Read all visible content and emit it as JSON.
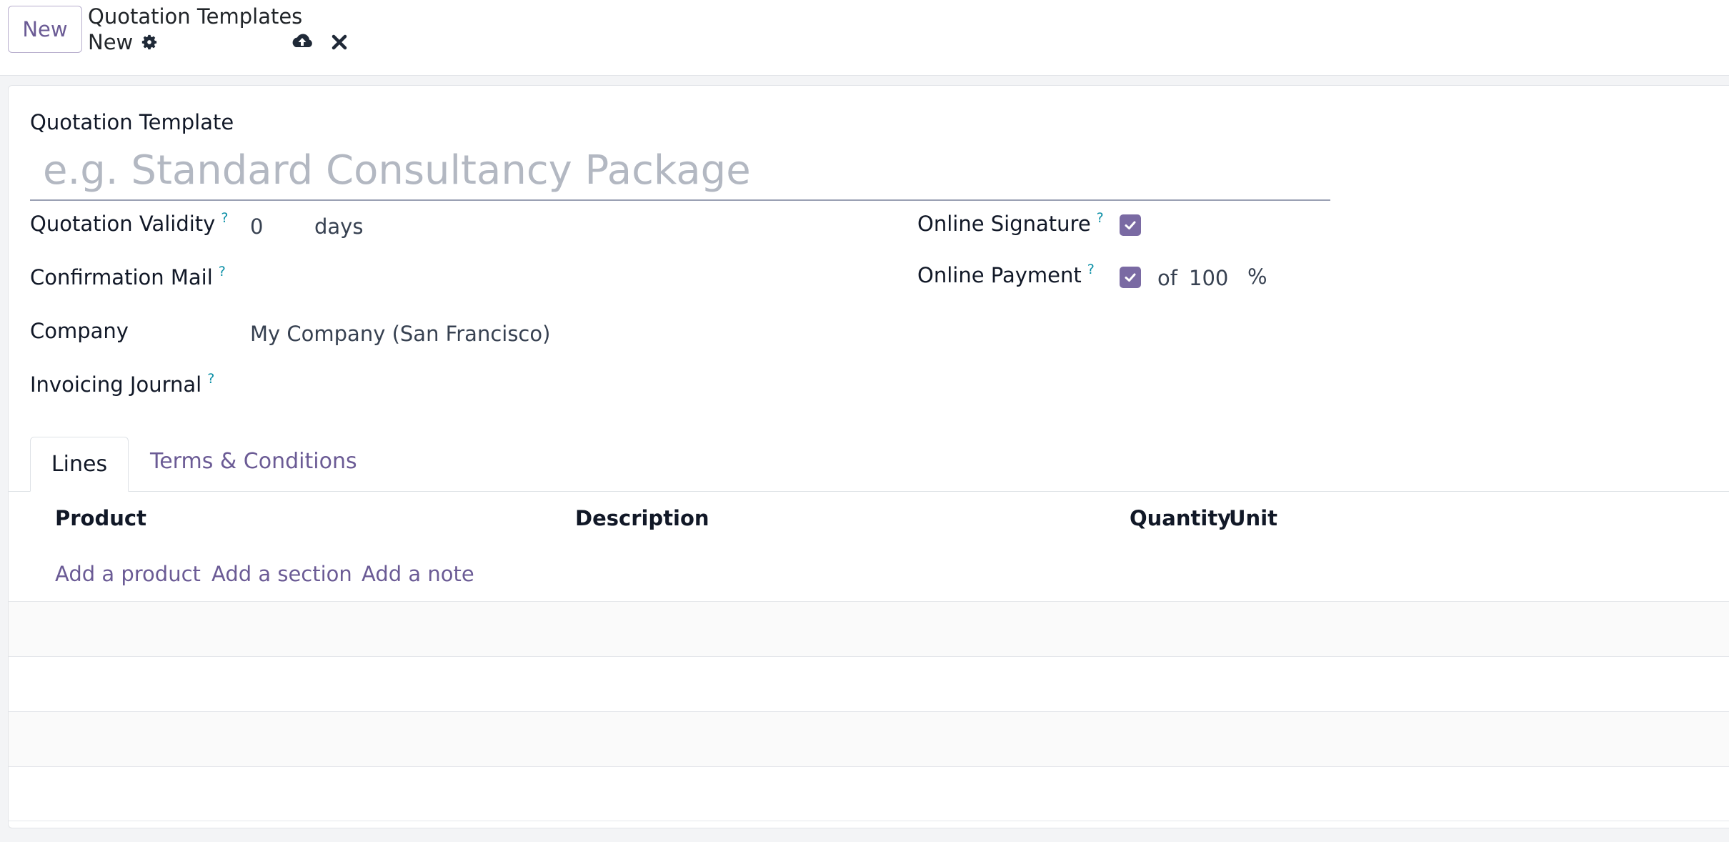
{
  "topbar": {
    "new_button": "New",
    "breadcrumb_parent": "Quotation Templates",
    "breadcrumb_current": "New"
  },
  "form": {
    "name_label": "Quotation Template",
    "name_placeholder": "e.g. Standard Consultancy Package",
    "name_value": "",
    "help_mark": "?",
    "left": {
      "validity_label": "Quotation Validity",
      "validity_value": "0",
      "validity_unit": "days",
      "confirmation_label": "Confirmation Mail",
      "company_label": "Company",
      "company_value": "My Company (San Francisco)",
      "journal_label": "Invoicing Journal"
    },
    "right": {
      "signature_label": "Online Signature",
      "signature_checked": true,
      "payment_label": "Online Payment",
      "payment_checked": true,
      "payment_of": "of",
      "payment_value": "100",
      "payment_unit": "%"
    }
  },
  "tabs": [
    {
      "label": "Lines",
      "active": true
    },
    {
      "label": "Terms & Conditions",
      "active": false
    }
  ],
  "lines_table": {
    "columns": [
      "Product",
      "Description",
      "Quantity",
      "Unit"
    ],
    "actions": [
      "Add a product",
      "Add a section",
      "Add a note"
    ],
    "rows": []
  },
  "colors": {
    "accent": "#6b5b95",
    "checkbox": "#7a6aa3",
    "help": "#0b8fa6"
  }
}
